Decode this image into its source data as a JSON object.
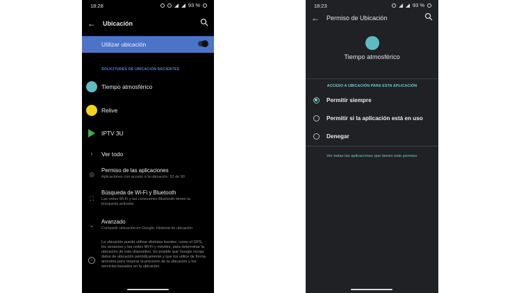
{
  "left": {
    "status": {
      "time": "18:28",
      "battery": "93 %"
    },
    "header": {
      "title": "Ubicación"
    },
    "toggle": {
      "label": "Utilizar ubicación",
      "on": true
    },
    "section_title": "SOLICITUDES DE UBICACIÓN RECIENTES",
    "recent_apps": [
      {
        "label": "Tiempo atmosférico",
        "icon": "weather-icon",
        "color": "#5ebbc3"
      },
      {
        "label": "Relive",
        "icon": "relive-icon",
        "color": "#f5d21d"
      },
      {
        "label": "IPTV 3U",
        "icon": "play-icon",
        "color": "#39b24a"
      }
    ],
    "see_all": "Ver todo",
    "settings": [
      {
        "title": "Permiso de las aplicaciones",
        "subtitle": "Aplicaciones con acceso a la ubicación: 52 de 90",
        "icon": "location-pin-icon"
      },
      {
        "title": "Búsqueda de Wi-Fi y Bluetooth",
        "subtitle_lines": [
          "Las redes Wi-Fi y las conexiones Bluetooth tienen la",
          "búsqueda activada"
        ],
        "icon": "scan-icon"
      },
      {
        "title": "Avanzado",
        "subtitle": "Compartir ubicación en Google, Historial de ubicación",
        "icon": "chevron-down-icon"
      }
    ],
    "info_text": "La ubicación puede utilizar distintas fuentes, como el GPS, los sensores y las redes Wi-Fi y móviles, para determinar la ubicación de este dispositivo. Es posible que Google recoja datos de ubicación periódicamente y que los utilice de forma anónima para mejorar la precisión de la ubicación y los servicios basados en la ubicación."
  },
  "right": {
    "status": {
      "time": "18:23",
      "battery": "93 %"
    },
    "header": {
      "title": "Permiso de Ubicación"
    },
    "app_name": "Tiempo atmosférico",
    "access_title": "ACCESO A UBICACIÓN PARA ESTA APLICACIÓN",
    "options": [
      {
        "label": "Permitir siempre",
        "selected": true
      },
      {
        "label": "Permitir si la aplicación está en uso",
        "selected": false
      },
      {
        "label": "Denegar",
        "selected": false
      }
    ],
    "link_text": "Ver todas las aplicaciones que tienen este permiso"
  },
  "colors": {
    "accent_blue": "#4b74c8",
    "teal": "#76d1c9"
  }
}
